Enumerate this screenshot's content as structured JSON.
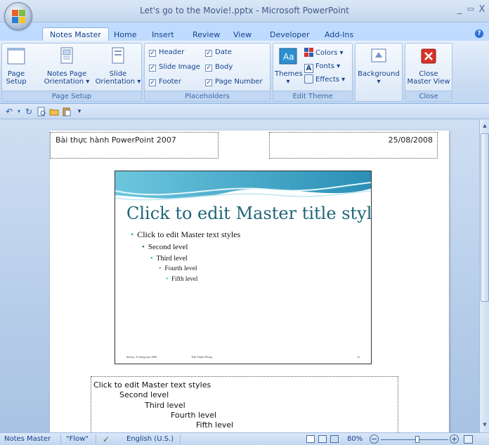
{
  "window": {
    "title": "Let's go to the Movie!.pptx - Microsoft PowerPoint",
    "minimize": "_",
    "maximize": "▭",
    "close": "X"
  },
  "tabs": [
    {
      "label": "Notes Master",
      "active": true
    },
    {
      "label": "Home"
    },
    {
      "label": "Insert"
    },
    {
      "label": "Review"
    },
    {
      "label": "View"
    },
    {
      "label": "Developer"
    },
    {
      "label": "Add-Ins"
    }
  ],
  "ribbon": {
    "page_setup_group": {
      "label": "Page Setup",
      "page_setup": "Page Setup",
      "notes_page_orientation_1": "Notes Page",
      "notes_page_orientation_2": "Orientation ▾",
      "slide_orientation_1": "Slide",
      "slide_orientation_2": "Orientation ▾"
    },
    "placeholders_group": {
      "label": "Placeholders",
      "header": "Header",
      "slide_image": "Slide Image",
      "footer": "Footer",
      "date": "Date",
      "body": "Body",
      "page_number": "Page Number"
    },
    "edit_theme_group": {
      "label": "Edit Theme",
      "themes_1": "Themes",
      "themes_2": "▾",
      "colors": "Colors ▾",
      "fonts": "Fonts ▾",
      "effects": "Effects ▾"
    },
    "background_group": {
      "background": "Background",
      "background_2": "▾"
    },
    "close_group": {
      "label": "Close",
      "close_master_1": "Close",
      "close_master_2": "Master View"
    }
  },
  "page": {
    "header_text": "Bài thực hành PowerPoint 2007",
    "date_text": "25/08/2008",
    "slide": {
      "title": "Click to edit Master title style",
      "level1": "Click to edit Master text styles",
      "level2": "Second level",
      "level3": "Third level",
      "level4": "Fourth level",
      "level5": "Fifth level",
      "footer_left": "thứ hai, 25 tháng tám 2008",
      "footer_mid": "Trần Thanh Phong",
      "footer_right": "‹#›"
    },
    "notes": {
      "level1": "Click to edit Master text styles",
      "level2": "Second level",
      "level3": "Third level",
      "level4": "Fourth level",
      "level5": "Fifth level"
    }
  },
  "status": {
    "view": "Notes Master",
    "theme": "\"Flow\"",
    "language": "English (U.S.)",
    "zoom": "80%"
  },
  "colors": {
    "accent": "#15428b",
    "ribbon": "#c9dbf2",
    "slide_title": "#1f6577",
    "close_red": "#d9322a"
  }
}
